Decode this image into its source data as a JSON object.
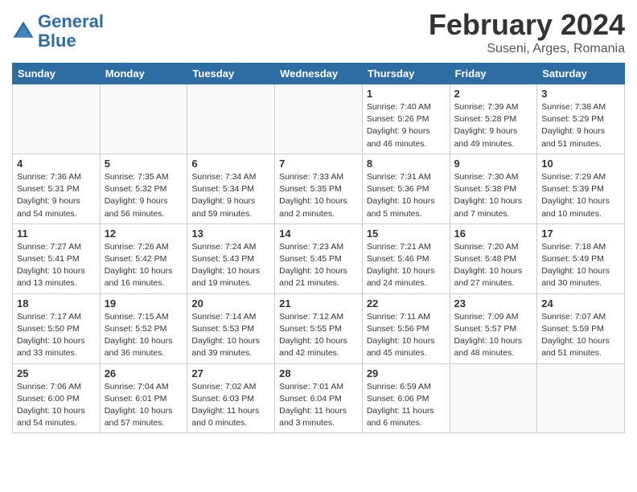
{
  "logo": {
    "line1": "General",
    "line2": "Blue"
  },
  "title": "February 2024",
  "location": "Suseni, Arges, Romania",
  "days_of_week": [
    "Sunday",
    "Monday",
    "Tuesday",
    "Wednesday",
    "Thursday",
    "Friday",
    "Saturday"
  ],
  "weeks": [
    [
      {
        "day": "",
        "info": ""
      },
      {
        "day": "",
        "info": ""
      },
      {
        "day": "",
        "info": ""
      },
      {
        "day": "",
        "info": ""
      },
      {
        "day": "1",
        "info": "Sunrise: 7:40 AM\nSunset: 5:26 PM\nDaylight: 9 hours\nand 46 minutes."
      },
      {
        "day": "2",
        "info": "Sunrise: 7:39 AM\nSunset: 5:28 PM\nDaylight: 9 hours\nand 49 minutes."
      },
      {
        "day": "3",
        "info": "Sunrise: 7:38 AM\nSunset: 5:29 PM\nDaylight: 9 hours\nand 51 minutes."
      }
    ],
    [
      {
        "day": "4",
        "info": "Sunrise: 7:36 AM\nSunset: 5:31 PM\nDaylight: 9 hours\nand 54 minutes."
      },
      {
        "day": "5",
        "info": "Sunrise: 7:35 AM\nSunset: 5:32 PM\nDaylight: 9 hours\nand 56 minutes."
      },
      {
        "day": "6",
        "info": "Sunrise: 7:34 AM\nSunset: 5:34 PM\nDaylight: 9 hours\nand 59 minutes."
      },
      {
        "day": "7",
        "info": "Sunrise: 7:33 AM\nSunset: 5:35 PM\nDaylight: 10 hours\nand 2 minutes."
      },
      {
        "day": "8",
        "info": "Sunrise: 7:31 AM\nSunset: 5:36 PM\nDaylight: 10 hours\nand 5 minutes."
      },
      {
        "day": "9",
        "info": "Sunrise: 7:30 AM\nSunset: 5:38 PM\nDaylight: 10 hours\nand 7 minutes."
      },
      {
        "day": "10",
        "info": "Sunrise: 7:29 AM\nSunset: 5:39 PM\nDaylight: 10 hours\nand 10 minutes."
      }
    ],
    [
      {
        "day": "11",
        "info": "Sunrise: 7:27 AM\nSunset: 5:41 PM\nDaylight: 10 hours\nand 13 minutes."
      },
      {
        "day": "12",
        "info": "Sunrise: 7:26 AM\nSunset: 5:42 PM\nDaylight: 10 hours\nand 16 minutes."
      },
      {
        "day": "13",
        "info": "Sunrise: 7:24 AM\nSunset: 5:43 PM\nDaylight: 10 hours\nand 19 minutes."
      },
      {
        "day": "14",
        "info": "Sunrise: 7:23 AM\nSunset: 5:45 PM\nDaylight: 10 hours\nand 21 minutes."
      },
      {
        "day": "15",
        "info": "Sunrise: 7:21 AM\nSunset: 5:46 PM\nDaylight: 10 hours\nand 24 minutes."
      },
      {
        "day": "16",
        "info": "Sunrise: 7:20 AM\nSunset: 5:48 PM\nDaylight: 10 hours\nand 27 minutes."
      },
      {
        "day": "17",
        "info": "Sunrise: 7:18 AM\nSunset: 5:49 PM\nDaylight: 10 hours\nand 30 minutes."
      }
    ],
    [
      {
        "day": "18",
        "info": "Sunrise: 7:17 AM\nSunset: 5:50 PM\nDaylight: 10 hours\nand 33 minutes."
      },
      {
        "day": "19",
        "info": "Sunrise: 7:15 AM\nSunset: 5:52 PM\nDaylight: 10 hours\nand 36 minutes."
      },
      {
        "day": "20",
        "info": "Sunrise: 7:14 AM\nSunset: 5:53 PM\nDaylight: 10 hours\nand 39 minutes."
      },
      {
        "day": "21",
        "info": "Sunrise: 7:12 AM\nSunset: 5:55 PM\nDaylight: 10 hours\nand 42 minutes."
      },
      {
        "day": "22",
        "info": "Sunrise: 7:11 AM\nSunset: 5:56 PM\nDaylight: 10 hours\nand 45 minutes."
      },
      {
        "day": "23",
        "info": "Sunrise: 7:09 AM\nSunset: 5:57 PM\nDaylight: 10 hours\nand 48 minutes."
      },
      {
        "day": "24",
        "info": "Sunrise: 7:07 AM\nSunset: 5:59 PM\nDaylight: 10 hours\nand 51 minutes."
      }
    ],
    [
      {
        "day": "25",
        "info": "Sunrise: 7:06 AM\nSunset: 6:00 PM\nDaylight: 10 hours\nand 54 minutes."
      },
      {
        "day": "26",
        "info": "Sunrise: 7:04 AM\nSunset: 6:01 PM\nDaylight: 10 hours\nand 57 minutes."
      },
      {
        "day": "27",
        "info": "Sunrise: 7:02 AM\nSunset: 6:03 PM\nDaylight: 11 hours\nand 0 minutes."
      },
      {
        "day": "28",
        "info": "Sunrise: 7:01 AM\nSunset: 6:04 PM\nDaylight: 11 hours\nand 3 minutes."
      },
      {
        "day": "29",
        "info": "Sunrise: 6:59 AM\nSunset: 6:06 PM\nDaylight: 11 hours\nand 6 minutes."
      },
      {
        "day": "",
        "info": ""
      },
      {
        "day": "",
        "info": ""
      }
    ]
  ]
}
